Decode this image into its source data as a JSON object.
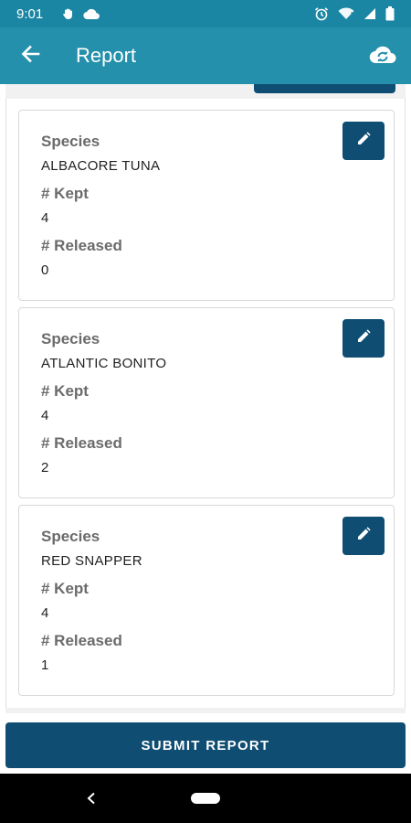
{
  "status_bar": {
    "time": "9:01",
    "icons": [
      "hand-notification-icon",
      "cloud-notification-icon",
      "alarm-icon",
      "wifi-icon",
      "signal-icon",
      "battery-icon"
    ]
  },
  "app_bar": {
    "title": "Report",
    "back_icon": "arrow-left-icon",
    "action_icon": "cloud-sync-icon"
  },
  "catches": [
    {
      "species_label": "Species",
      "species": "ALBACORE TUNA",
      "kept_label": "# Kept",
      "kept": "4",
      "released_label": "# Released",
      "released": "0"
    },
    {
      "species_label": "Species",
      "species": "ATLANTIC BONITO",
      "kept_label": "# Kept",
      "kept": "4",
      "released_label": "# Released",
      "released": "2"
    },
    {
      "species_label": "Species",
      "species": "RED SNAPPER",
      "kept_label": "# Kept",
      "kept": "4",
      "released_label": "# Released",
      "released": "1"
    }
  ],
  "submit_label": "SUBMIT REPORT",
  "colors": {
    "status_bar": "#1a86a3",
    "app_bar": "#2590ac",
    "primary_dark": "#0f4d72"
  }
}
